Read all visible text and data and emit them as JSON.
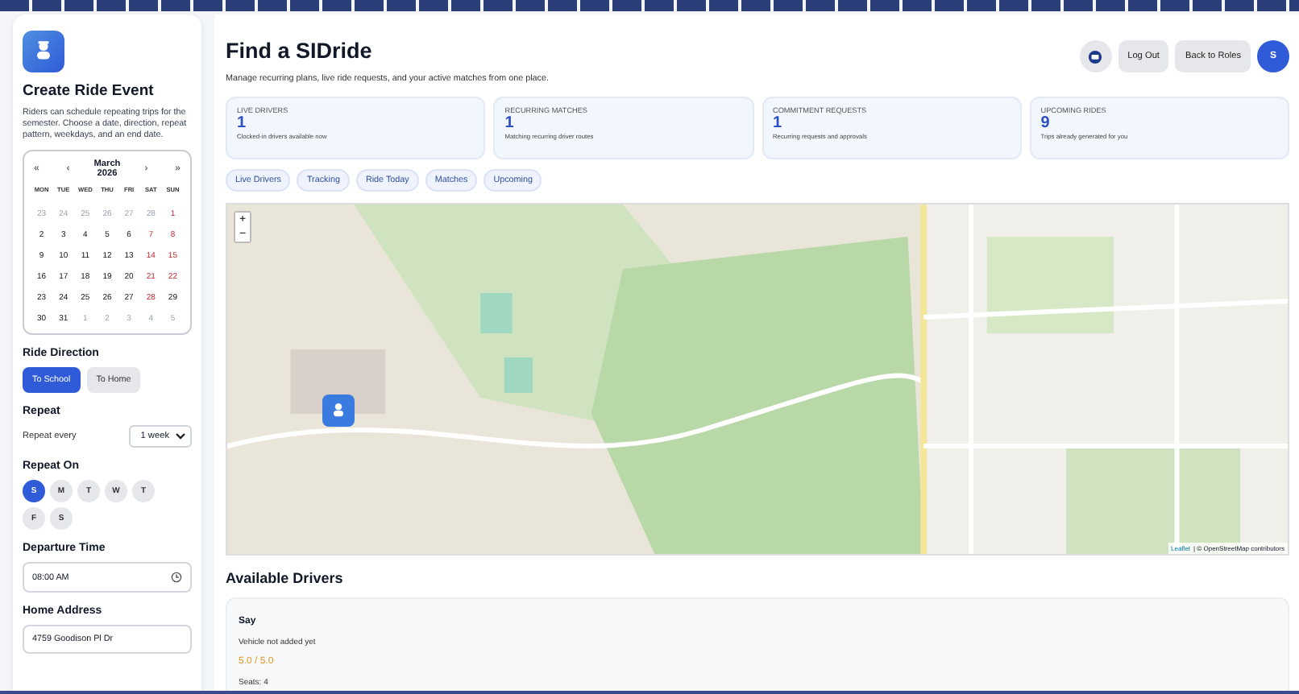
{
  "sidebar": {
    "title": "Create Ride Event",
    "description": "Riders can schedule repeating trips for the semester. Choose a date, direction, repeat pattern, weekdays, and an end date.",
    "calendar": {
      "nav_first": "«",
      "nav_prev": "‹",
      "month": "March",
      "year": "2026",
      "nav_next": "›",
      "nav_last": "»",
      "weekdays": [
        "MON",
        "TUE",
        "WED",
        "THU",
        "FRI",
        "SAT",
        "SUN"
      ],
      "weeks": [
        [
          {
            "day": "23",
            "kind": "muted"
          },
          {
            "day": "24",
            "kind": "muted"
          },
          {
            "day": "25",
            "kind": "muted"
          },
          {
            "day": "26",
            "kind": "muted"
          },
          {
            "day": "27",
            "kind": "muted"
          },
          {
            "day": "28",
            "kind": "muted"
          },
          {
            "day": "1",
            "kind": "weekend"
          }
        ],
        [
          {
            "day": "2",
            "kind": "normal"
          },
          {
            "day": "3",
            "kind": "normal"
          },
          {
            "day": "4",
            "kind": "normal"
          },
          {
            "day": "5",
            "kind": "normal"
          },
          {
            "day": "6",
            "kind": "normal"
          },
          {
            "day": "7",
            "kind": "weekend"
          },
          {
            "day": "8",
            "kind": "weekend"
          }
        ],
        [
          {
            "day": "9",
            "kind": "normal"
          },
          {
            "day": "10",
            "kind": "normal"
          },
          {
            "day": "11",
            "kind": "normal"
          },
          {
            "day": "12",
            "kind": "normal"
          },
          {
            "day": "13",
            "kind": "normal"
          },
          {
            "day": "14",
            "kind": "weekend"
          },
          {
            "day": "15",
            "kind": "weekend"
          }
        ],
        [
          {
            "day": "16",
            "kind": "normal"
          },
          {
            "day": "17",
            "kind": "normal"
          },
          {
            "day": "18",
            "kind": "normal"
          },
          {
            "day": "19",
            "kind": "normal"
          },
          {
            "day": "20",
            "kind": "normal"
          },
          {
            "day": "21",
            "kind": "weekend"
          },
          {
            "day": "22",
            "kind": "weekend"
          }
        ],
        [
          {
            "day": "23",
            "kind": "normal"
          },
          {
            "day": "24",
            "kind": "normal"
          },
          {
            "day": "25",
            "kind": "normal"
          },
          {
            "day": "26",
            "kind": "normal"
          },
          {
            "day": "27",
            "kind": "normal"
          },
          {
            "day": "28",
            "kind": "weekend"
          },
          {
            "day": "29",
            "kind": "normal"
          }
        ],
        [
          {
            "day": "30",
            "kind": "normal"
          },
          {
            "day": "31",
            "kind": "normal"
          },
          {
            "day": "1",
            "kind": "muted"
          },
          {
            "day": "2",
            "kind": "muted"
          },
          {
            "day": "3",
            "kind": "muted"
          },
          {
            "day": "4",
            "kind": "muted"
          },
          {
            "day": "5",
            "kind": "muted"
          }
        ]
      ]
    },
    "direction": {
      "label": "Ride Direction",
      "options": [
        {
          "label": "To School",
          "selected": true
        },
        {
          "label": "To Home",
          "selected": false
        }
      ]
    },
    "repeat": {
      "label": "Repeat",
      "field_label": "Repeat every",
      "value": "1 week"
    },
    "repeat_on": {
      "label": "Repeat On",
      "days": [
        {
          "label": "S",
          "selected": true
        },
        {
          "label": "M",
          "selected": false
        },
        {
          "label": "T",
          "selected": false
        },
        {
          "label": "W",
          "selected": false
        },
        {
          "label": "T",
          "selected": false
        },
        {
          "label": "F",
          "selected": false
        },
        {
          "label": "S",
          "selected": false
        }
      ]
    },
    "departure": {
      "label": "Departure Time",
      "value": "08:00 AM"
    },
    "home_address": {
      "label": "Home Address",
      "value": "4759 Goodison Pl Dr"
    }
  },
  "header": {
    "title": "Find a SIDride",
    "subtitle": "Manage recurring plans, live ride requests, and your active matches from one place.",
    "buttons": [
      "Log Out",
      "Back to Roles"
    ],
    "avatar": "S"
  },
  "stats": [
    {
      "label": "LIVE DRIVERS",
      "value": "1",
      "caption": "Clocked-in drivers available now"
    },
    {
      "label": "RECURRING MATCHES",
      "value": "1",
      "caption": "Matching recurring driver routes"
    },
    {
      "label": "COMMITMENT REQUESTS",
      "value": "1",
      "caption": "Recurring requests and approvals"
    },
    {
      "label": "UPCOMING RIDES",
      "value": "9",
      "caption": "Trips already generated for you"
    }
  ],
  "tabs": [
    "Live Drivers",
    "Tracking",
    "Ride Today",
    "Matches",
    "Upcoming"
  ],
  "map": {
    "zoom_in": "+",
    "zoom_out": "−",
    "attribution_link": "Leaflet",
    "attribution": "| © OpenStreetMap contributors"
  },
  "drivers": {
    "title": "Available Drivers",
    "items": [
      {
        "name": "Say",
        "vehicle": "Vehicle not added yet",
        "rating": "5.0 / 5.0",
        "seats": "Seats: 4"
      }
    ]
  }
}
